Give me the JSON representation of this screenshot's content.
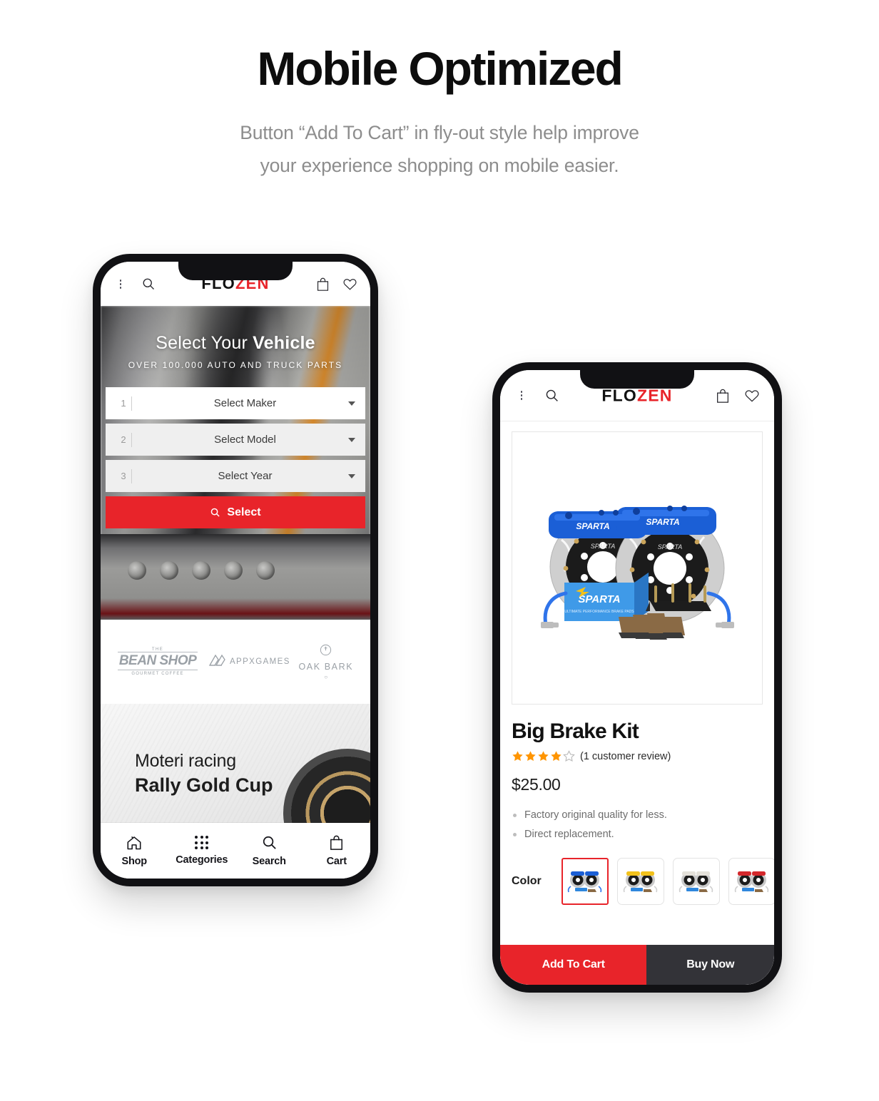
{
  "page": {
    "title": "Mobile Optimized",
    "subtitle_line1": "Button “Add To Cart” in fly-out style help improve",
    "subtitle_line2": "your experience shopping on mobile easier."
  },
  "colors": {
    "brand_red": "#e8242a",
    "dark": "#333338",
    "star": "#ff9500",
    "muted": "#8d8d8d"
  },
  "brand": {
    "part1": "FLO",
    "part2": "ZEN"
  },
  "phone1": {
    "header": {
      "menu_icon": "hamburger-icon",
      "search_icon": "search-icon",
      "bag_icon": "bag-icon",
      "wishlist_icon": "heart-icon"
    },
    "hero": {
      "title_light": "Select Your ",
      "title_bold": "Vehicle",
      "tagline": "OVER 100.000 AUTO AND TRUCK PARTS"
    },
    "finder": {
      "rows": [
        {
          "num": "1",
          "label": "Select Maker",
          "style": "white"
        },
        {
          "num": "2",
          "label": "Select Model",
          "style": "gray"
        },
        {
          "num": "3",
          "label": "Select Year",
          "style": "gray"
        }
      ],
      "button_label": "Select",
      "button_icon": "search-icon"
    },
    "brands": [
      {
        "line1": "THE",
        "line2": "BEAN SHOP",
        "line3": "GOURMET COFFEE"
      },
      {
        "line1": "",
        "line2": "APPXGAMES",
        "line3": ""
      },
      {
        "line1": "",
        "line2": "OAK BARK",
        "line3": ""
      }
    ],
    "promo": {
      "line1": "Moteri racing",
      "line2": "Rally Gold Cup"
    },
    "tabs": [
      {
        "label": "Shop",
        "icon": "home-icon"
      },
      {
        "label": "Categories",
        "icon": "grid-dots-icon"
      },
      {
        "label": "Search",
        "icon": "search-icon"
      },
      {
        "label": "Cart",
        "icon": "bag-icon"
      }
    ]
  },
  "phone2": {
    "header": {
      "menu_icon": "hamburger-icon",
      "search_icon": "search-icon",
      "bag_icon": "bag-icon",
      "wishlist_icon": "heart-icon"
    },
    "product": {
      "image_alt": "sparta-big-brake-kit-image",
      "name": "Big Brake Kit",
      "rating_filled": 4,
      "rating_total": 5,
      "review_text": "(1 customer review)",
      "price": "$25.00",
      "features": [
        "Factory original quality for less.",
        "Direct replacement."
      ],
      "color_label": "Color",
      "swatches": [
        {
          "name": "blue",
          "hex": "#1b5fd6",
          "selected": true
        },
        {
          "name": "yellow",
          "hex": "#f2c11b",
          "selected": false
        },
        {
          "name": "silver",
          "hex": "#d9d9d9",
          "selected": false
        },
        {
          "name": "red",
          "hex": "#d4282c",
          "selected": false
        }
      ]
    },
    "cta": {
      "add_label": "Add To Cart",
      "buy_label": "Buy Now"
    }
  }
}
